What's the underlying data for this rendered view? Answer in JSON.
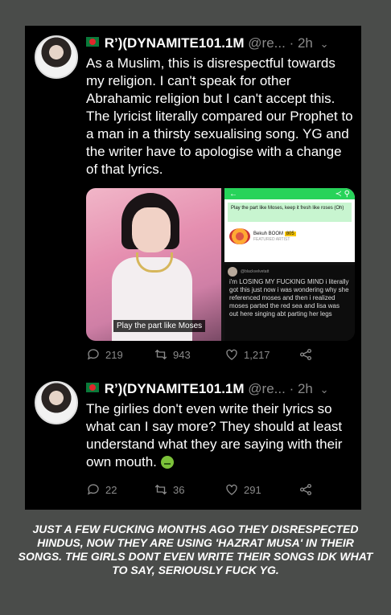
{
  "tweet1": {
    "flag_icon": "bangladesh-flag-icon",
    "display_name": "R’)(DYNAMITE101.1M",
    "handle": "@re...",
    "time": "· 2h",
    "text": "As a Muslim, this is disrespectful towards my religion. I can't speak for other Abrahamic religion but I can't accept this. The lyricist literally compared our Prophet to a man in a thirsty sexualising song. YG and the writer have to apologise with a change of that lyrics.",
    "media": {
      "photo_caption": "Play the part like Moses",
      "app_lyric": "Play the part like Moses, keep it fresh like roses (Oh)",
      "artist_name": "Bekuh BOOM",
      "artist_badge": "805",
      "artist_sub": "FEATURED ARTIST",
      "embedded_handle": "@blackvelvetatt",
      "embedded_text": "i'm LOSING MY FUCKING MIND i literally got this just now i was wondering why she referenced moses and then i realized moses parted the red sea and lisa was out here singing abt parting her legs"
    },
    "replies": "219",
    "retweets": "943",
    "likes": "1,217"
  },
  "tweet2": {
    "flag_icon": "bangladesh-flag-icon",
    "display_name": "R’)(DYNAMITE101.1M",
    "handle": "@re...",
    "time": "· 2h",
    "text": "The girlies don't even write their lyrics so what can I say more? They should at least understand what they are saying with their own mouth.",
    "emoji": "nauseated-face-emoji",
    "replies": "22",
    "retweets": "36",
    "likes": "291"
  },
  "caption": "JUST A FEW FUCKING MONTHS AGO THEY DISRESPECTED HINDUS, NOW THEY ARE USING 'HAZRAT MUSA' IN THEIR SONGS. THE GIRLS DONT EVEN WRITE THEIR SONGS IDK WHAT TO SAY, SERIOUSLY FUCK YG.",
  "colors": {
    "background": "#4a4c4a",
    "tweet_bg": "#000000",
    "muted": "#8a8a8a",
    "app_green": "#27d35a"
  }
}
